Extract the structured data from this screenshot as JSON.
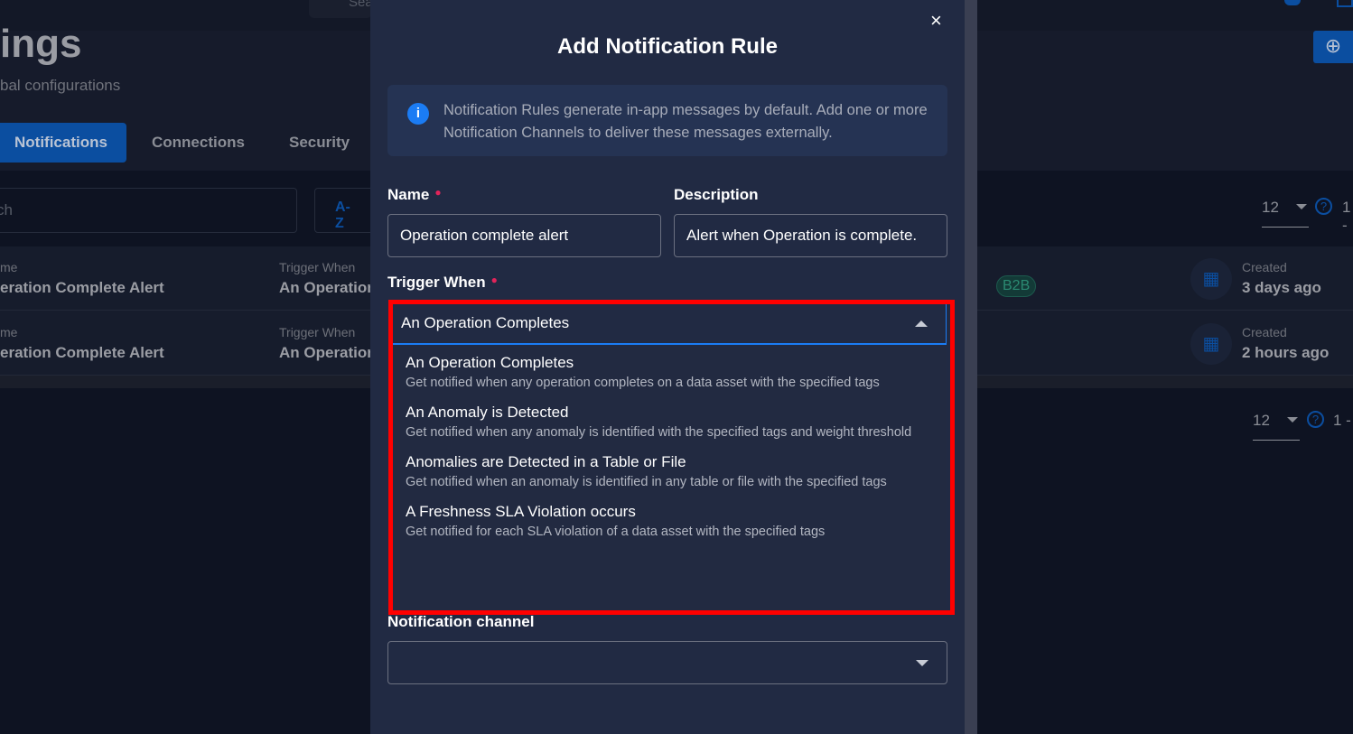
{
  "background": {
    "top_search_placeholder": "Sea",
    "page_title": "ings",
    "page_subtitle": "bal configurations",
    "tabs": [
      {
        "label": "Notifications",
        "active": true
      },
      {
        "label": "Connections"
      },
      {
        "label": "Security"
      }
    ],
    "search_placeholder": "ch",
    "sort_icon": "A-Z",
    "page_size": "12",
    "range": "1 -",
    "rows": [
      {
        "name_label": "me",
        "name": "eration Complete Alert",
        "trigger_label": "Trigger When",
        "trigger": "An Operation",
        "tag": "B2B",
        "created_label": "Created",
        "created": "3 days ago"
      },
      {
        "name_label": "me",
        "name": "eration Complete Alert",
        "trigger_label": "Trigger When",
        "trigger": "An Operation",
        "created_label": "Created",
        "created": "2 hours ago"
      }
    ]
  },
  "modal": {
    "title": "Add Notification Rule",
    "close": "×",
    "info": "Notification Rules generate in-app messages by default. Add one or more Notification Channels to deliver these messages externally.",
    "name_label": "Name",
    "name_value": "Operation complete alert",
    "description_label": "Description",
    "description_value": "Alert when Operation is complete.",
    "trigger_label": "Trigger When",
    "trigger_value": "An Operation Completes",
    "options": [
      {
        "title": "An Operation Completes",
        "desc": "Get notified when any operation completes on a data asset with the specified tags"
      },
      {
        "title": "An Anomaly is Detected",
        "desc": "Get notified when any anomaly is identified with the specified tags and weight threshold"
      },
      {
        "title": "Anomalies are Detected in a Table or File",
        "desc": "Get notified when an anomaly is identified in any table or file with the specified tags"
      },
      {
        "title": "A Freshness SLA Violation occurs",
        "desc": "Get notified for each SLA violation of a data asset with the specified tags"
      }
    ],
    "channel_label": "Notification channel",
    "channel_value": ""
  },
  "colors": {
    "accent": "#1b7cf4",
    "highlight": "#ff0000",
    "required": "#e2245a"
  }
}
